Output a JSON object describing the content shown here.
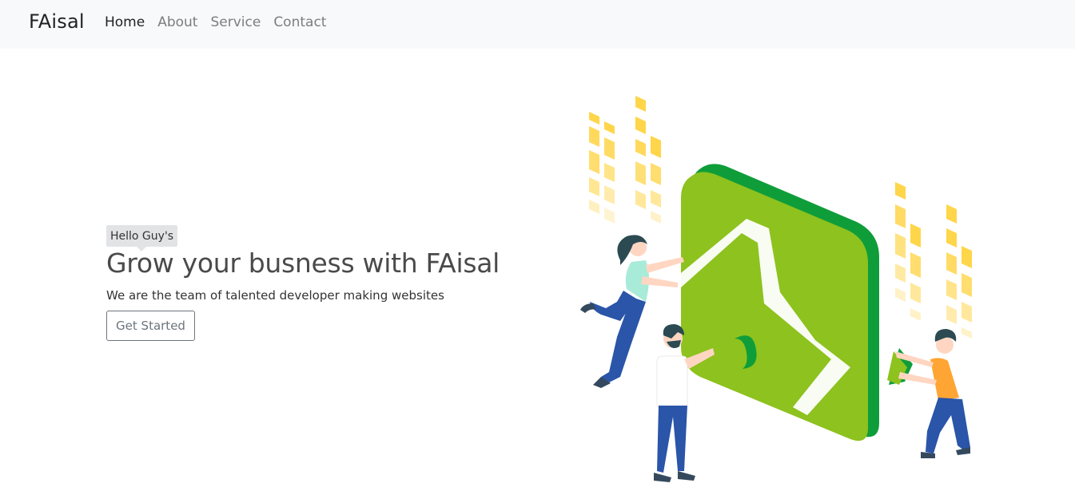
{
  "navbar": {
    "brand": "FAisal",
    "links": [
      "Home",
      "About",
      "Service",
      "Contact"
    ],
    "active": "Home"
  },
  "hero": {
    "badge": "Hello Guy's",
    "title": "Grow your busness with FAisal",
    "subtitle": "We are the team of talented developer making websites",
    "cta_label": "Get Started"
  },
  "colors": {
    "navbar_bg": "#f8f9fa",
    "green": "#8dc21f",
    "dark_green": "#0f9d3a",
    "yellow": "#ffd54a",
    "badge_bg": "#e2e3e5",
    "button_border": "#6c757d"
  }
}
